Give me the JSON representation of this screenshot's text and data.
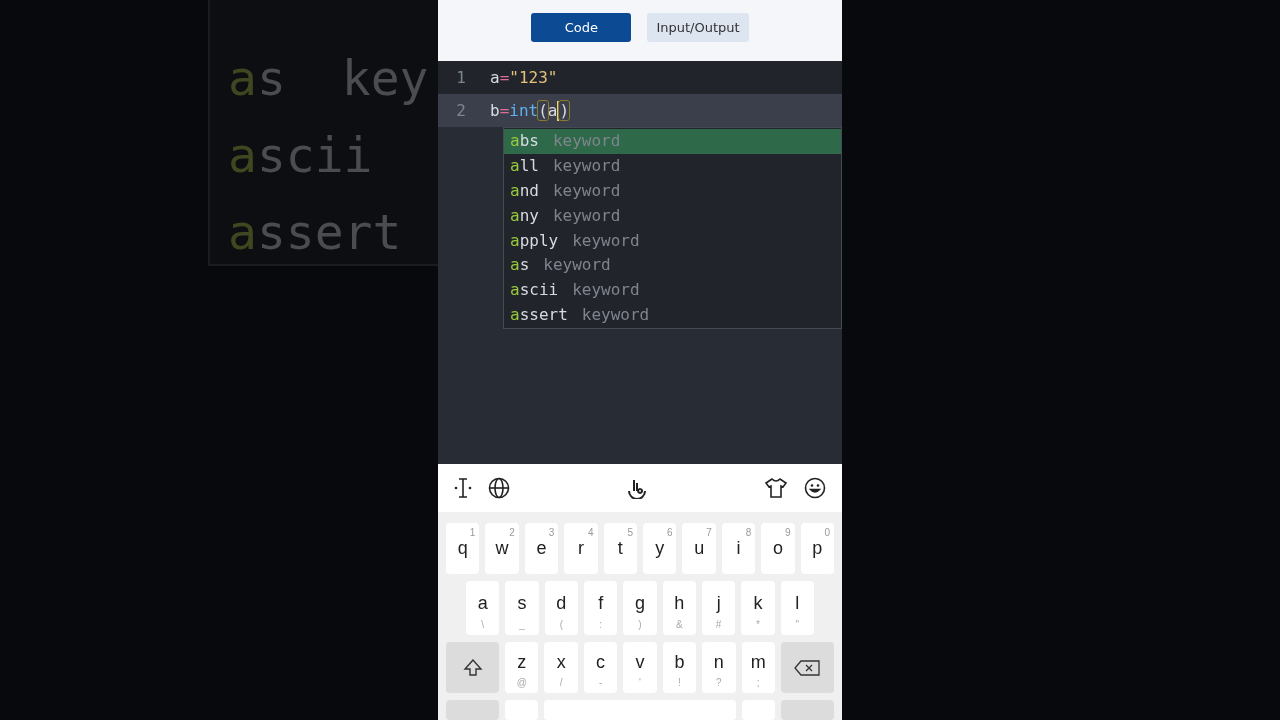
{
  "backdrop": {
    "lines": [
      {
        "match": "a",
        "rest": "s",
        "extra": "key"
      },
      {
        "match": "a",
        "rest": "scii"
      },
      {
        "match": "a",
        "rest": "ssert"
      }
    ]
  },
  "tabs": [
    {
      "label": "Code",
      "selected": true
    },
    {
      "label": "Input/Output",
      "selected": false
    }
  ],
  "editor": {
    "lines": [
      {
        "number": "1",
        "active": false,
        "tokens": [
          {
            "text": "a",
            "kind": "ident"
          },
          {
            "text": "=",
            "kind": "op"
          },
          {
            "text": "\"123\"",
            "kind": "string"
          }
        ]
      },
      {
        "number": "2",
        "active": true,
        "tokens": [
          {
            "text": "b",
            "kind": "ident"
          },
          {
            "text": "=",
            "kind": "op"
          },
          {
            "text": "int",
            "kind": "builtin"
          },
          {
            "text": "(",
            "kind": "bracket",
            "matched": true
          },
          {
            "text": "a",
            "kind": "ident"
          },
          {
            "kind": "cursor"
          },
          {
            "text": ")",
            "kind": "bracket",
            "matched": true
          }
        ]
      }
    ]
  },
  "autocomplete": {
    "items": [
      {
        "match": "a",
        "rest": "bs",
        "type": "keyword",
        "selected": true
      },
      {
        "match": "a",
        "rest": "ll",
        "type": "keyword",
        "selected": false
      },
      {
        "match": "a",
        "rest": "nd",
        "type": "keyword",
        "selected": false
      },
      {
        "match": "a",
        "rest": "ny",
        "type": "keyword",
        "selected": false
      },
      {
        "match": "a",
        "rest": "pply",
        "type": "keyword",
        "selected": false
      },
      {
        "match": "a",
        "rest": "s",
        "type": "keyword",
        "selected": false
      },
      {
        "match": "a",
        "rest": "scii",
        "type": "keyword",
        "selected": false
      },
      {
        "match": "a",
        "rest": "ssert",
        "type": "keyword",
        "selected": false
      }
    ]
  },
  "keyboard": {
    "rows": [
      {
        "keys": [
          {
            "kind": "letter",
            "label": "q",
            "hint": "1"
          },
          {
            "kind": "letter",
            "label": "w",
            "hint": "2"
          },
          {
            "kind": "letter",
            "label": "e",
            "hint": "3"
          },
          {
            "kind": "letter",
            "label": "r",
            "hint": "4"
          },
          {
            "kind": "letter",
            "label": "t",
            "hint": "5"
          },
          {
            "kind": "letter",
            "label": "y",
            "hint": "6"
          },
          {
            "kind": "letter",
            "label": "u",
            "hint": "7"
          },
          {
            "kind": "letter",
            "label": "i",
            "hint": "8"
          },
          {
            "kind": "letter",
            "label": "o",
            "hint": "9"
          },
          {
            "kind": "letter",
            "label": "p",
            "hint": "0"
          }
        ]
      },
      {
        "keys": [
          {
            "kind": "letter",
            "label": "a",
            "sub": "\\"
          },
          {
            "kind": "letter",
            "label": "s",
            "sub": "_"
          },
          {
            "kind": "letter",
            "label": "d",
            "sub": "("
          },
          {
            "kind": "letter",
            "label": "f",
            "sub": ":"
          },
          {
            "kind": "letter",
            "label": "g",
            "sub": ")"
          },
          {
            "kind": "letter",
            "label": "h",
            "sub": "&"
          },
          {
            "kind": "letter",
            "label": "j",
            "sub": "#"
          },
          {
            "kind": "letter",
            "label": "k",
            "sub": "*"
          },
          {
            "kind": "letter",
            "label": "l",
            "sub": "\""
          }
        ]
      },
      {
        "keys": [
          {
            "kind": "shift"
          },
          {
            "kind": "letter",
            "label": "z",
            "sub": "@"
          },
          {
            "kind": "letter",
            "label": "x",
            "sub": "/"
          },
          {
            "kind": "letter",
            "label": "c",
            "sub": "-"
          },
          {
            "kind": "letter",
            "label": "v",
            "sub": "'"
          },
          {
            "kind": "letter",
            "label": "b",
            "sub": "!"
          },
          {
            "kind": "letter",
            "label": "n",
            "sub": "?"
          },
          {
            "kind": "letter",
            "label": "m",
            "sub": ";"
          },
          {
            "kind": "backspace"
          }
        ]
      }
    ]
  }
}
